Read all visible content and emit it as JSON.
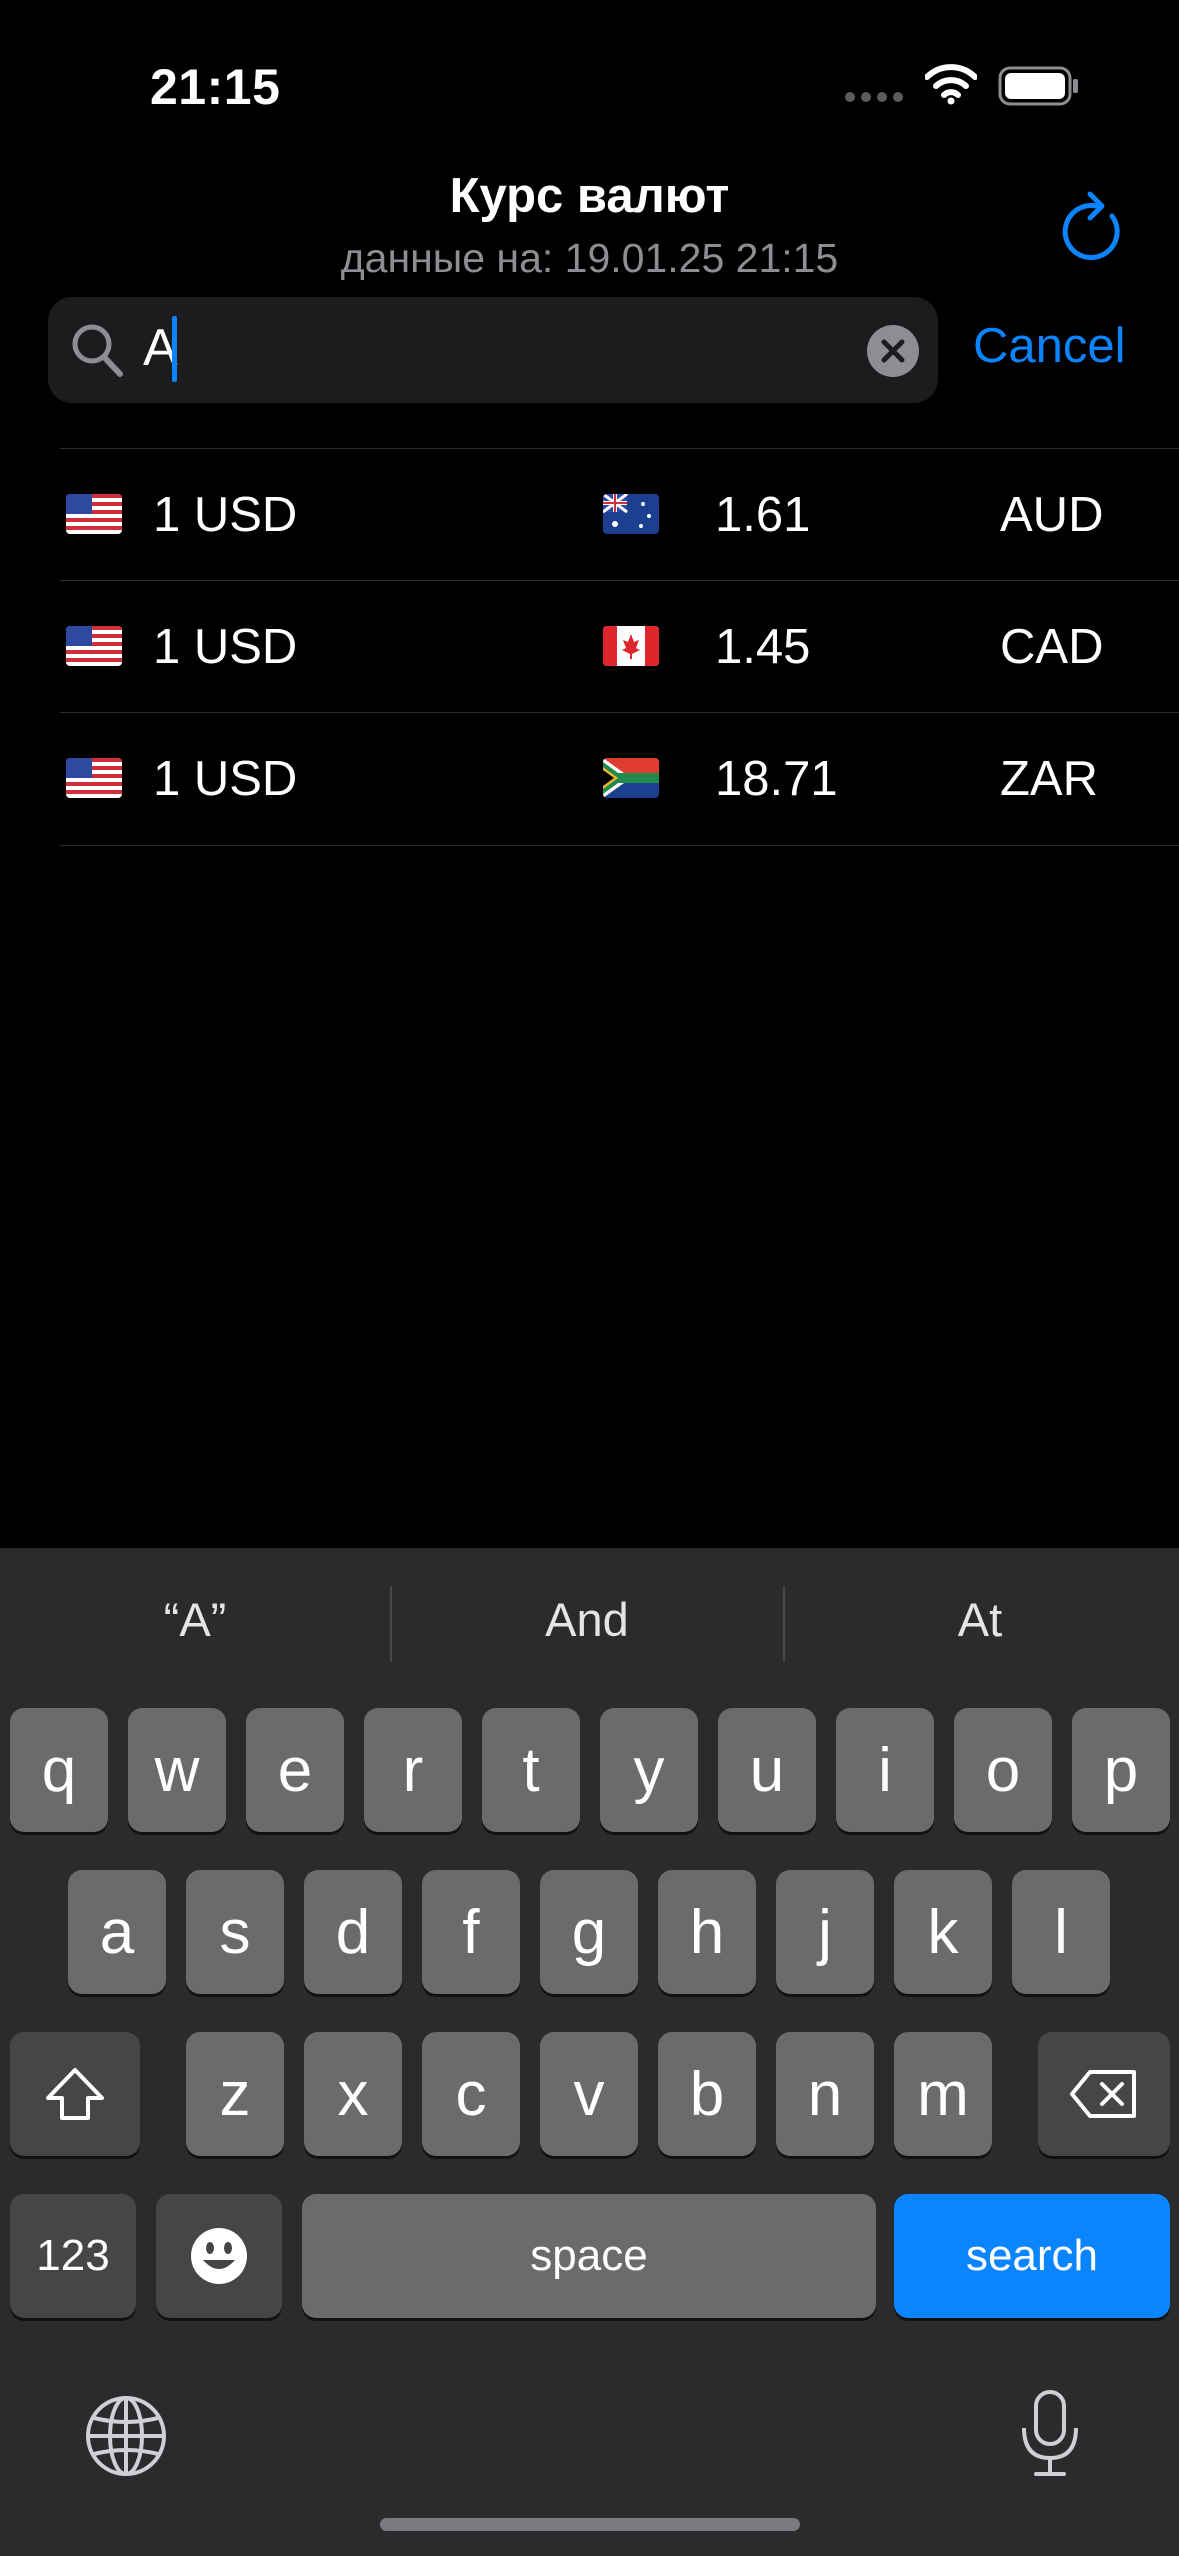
{
  "status_bar": {
    "time": "21:15"
  },
  "header": {
    "title": "Курс валют",
    "subtitle": "данные на: 19.01.25 21:15",
    "refresh_icon": "refresh-icon"
  },
  "search": {
    "value": "A",
    "cancel_label": "Cancel"
  },
  "rows": [
    {
      "base_flag": "us-flag",
      "base": "1 USD",
      "target_flag": "au-flag",
      "rate": "1.61",
      "code": "AUD"
    },
    {
      "base_flag": "us-flag",
      "base": "1 USD",
      "target_flag": "ca-flag",
      "rate": "1.45",
      "code": "CAD"
    },
    {
      "base_flag": "us-flag",
      "base": "1 USD",
      "target_flag": "za-flag",
      "rate": "18.71",
      "code": "ZAR"
    }
  ],
  "keyboard": {
    "suggestions": [
      "“A”",
      "And",
      "At"
    ],
    "row1": [
      "q",
      "w",
      "e",
      "r",
      "t",
      "y",
      "u",
      "i",
      "o",
      "p"
    ],
    "row2": [
      "a",
      "s",
      "d",
      "f",
      "g",
      "h",
      "j",
      "k",
      "l"
    ],
    "row3": [
      "z",
      "x",
      "c",
      "v",
      "b",
      "n",
      "m"
    ],
    "numbers_label": "123",
    "space_label": "space",
    "search_label": "search"
  },
  "colors": {
    "accent": "#0a84ff",
    "background": "#000000",
    "keyboard": "#2b2b2d"
  }
}
